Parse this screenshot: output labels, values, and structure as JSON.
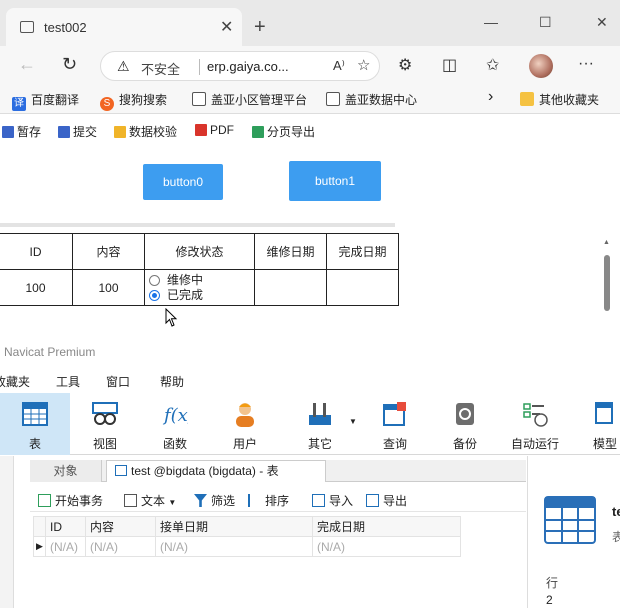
{
  "browser": {
    "tab_title": "test002",
    "tab_close": "✕",
    "new_tab": "+",
    "window_controls": [
      "—",
      "☐",
      "✕"
    ],
    "address": {
      "security_label": "不安全",
      "url": "erp.gaiya.co...",
      "read_aloud": "A⁾",
      "favorite": "☆"
    },
    "bookmarks": [
      {
        "label": "百度翻译",
        "icon": "translate-icon",
        "color": "#2b6de0",
        "glyph": "译"
      },
      {
        "label": "搜狗搜索",
        "icon": "sogou-icon",
        "color": "#f26522",
        "glyph": "S"
      },
      {
        "label": "盖亚小区管理平台",
        "icon": "page-icon",
        "color": "#555555",
        "glyph": ""
      },
      {
        "label": "盖亚数据中心",
        "icon": "page-icon",
        "color": "#555555",
        "glyph": ""
      }
    ],
    "bookmarks_more": "›",
    "other_bookmarks": "其他收藏夹"
  },
  "page": {
    "toolbar": [
      "暂存",
      "提交",
      "数据校验",
      "PDF",
      "分页导出"
    ],
    "button0": "button0",
    "button1": "button1",
    "table": {
      "headers": [
        "ID",
        "内容",
        "修改状态",
        "维修日期",
        "完成日期"
      ],
      "row": {
        "id": "100",
        "content": "100",
        "repair_date": "",
        "done_date": ""
      },
      "status_options": [
        {
          "label": "维修中",
          "checked": false
        },
        {
          "label": "已完成",
          "checked": true
        }
      ]
    }
  },
  "navicat": {
    "title": "Navicat Premium",
    "menu": [
      "收藏夹",
      "工具",
      "窗口",
      "帮助"
    ],
    "ribbon": [
      "表",
      "视图",
      "函数",
      "用户",
      "其它",
      "查询",
      "备份",
      "自动运行",
      "模型"
    ],
    "tabs": {
      "objects": "对象",
      "table_tab": "test @bigdata (bigdata) - 表"
    },
    "sub_toolbar": [
      "开始事务",
      "文本",
      "筛选",
      "排序",
      "导入",
      "导出"
    ],
    "grid": {
      "columns": [
        "ID",
        "内容",
        "接单日期",
        "完成日期"
      ],
      "row": [
        "(N/A)",
        "(N/A)",
        "(N/A)",
        "(N/A)"
      ]
    },
    "side_panel": {
      "title": "te",
      "subtitle": "表",
      "rows_label": "行",
      "rows_value": "2"
    }
  }
}
